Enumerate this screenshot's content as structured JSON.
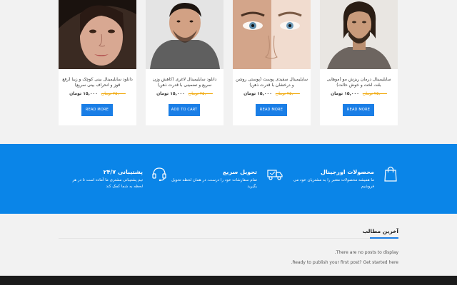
{
  "products": [
    {
      "title": "سایلیمینال درمان ریزش مو (موهایی بلند، لخت و خوش حالت)",
      "old_price": "۲۵,۰۰۰ تومان",
      "new_price": "۱۵,۰۰۰ تومان",
      "button": "READ MORE"
    },
    {
      "title": "سایلیمینال سفیدی پوست (پوستی روشن و درخشان با قدرت ذهن)",
      "old_price": "۲۵,۰۰۰ تومان",
      "new_price": "۱۵,۰۰۰ تومان",
      "button": "READ MORE"
    },
    {
      "title": "دانلود سایلیمینال لاغری (کاهش وزن سریع و تضمینی با قدرت ذهن)",
      "old_price": "۲۵,۰۰۰ تومان",
      "new_price": "۱۵,۰۰۰ تومان",
      "button": "ADD TO CART"
    },
    {
      "title": "دانلود سایلیمینال بینی کوچک و زیبا (رفع قوز و انحراف بینی سریع)",
      "old_price": "۲۵,۰۰۰ تومان",
      "new_price": "۱۵,۰۰۰ تومان",
      "button": "READ MORE"
    }
  ],
  "features": [
    {
      "title": "محصولات اورجینال",
      "desc": "ما همیشه محصولات معتبر را به مشتریان خود می فروشیم",
      "icon": "shopping-bag-icon"
    },
    {
      "title": "تحویل سریع",
      "desc": "تمام سفارشات خود را درست، در همان لحظه تحویل بگیرید",
      "icon": "delivery-truck-icon"
    },
    {
      "title": "پشتیبانی ۲۴/۷",
      "desc": "تیم پشتیبانی مشتری ما آماده است تا در هر لحظه به شما کمک کند",
      "icon": "headset-icon"
    }
  ],
  "posts": {
    "title": "آخرین مطالب",
    "empty": "There are no posts to display.",
    "cta": "Ready to publish your first post? Get started here."
  },
  "colors": {
    "accent": "#1a7ee6",
    "feature_band": "#0a85e8",
    "old_price": "#f0a500",
    "footer": "#1b1b1b"
  }
}
